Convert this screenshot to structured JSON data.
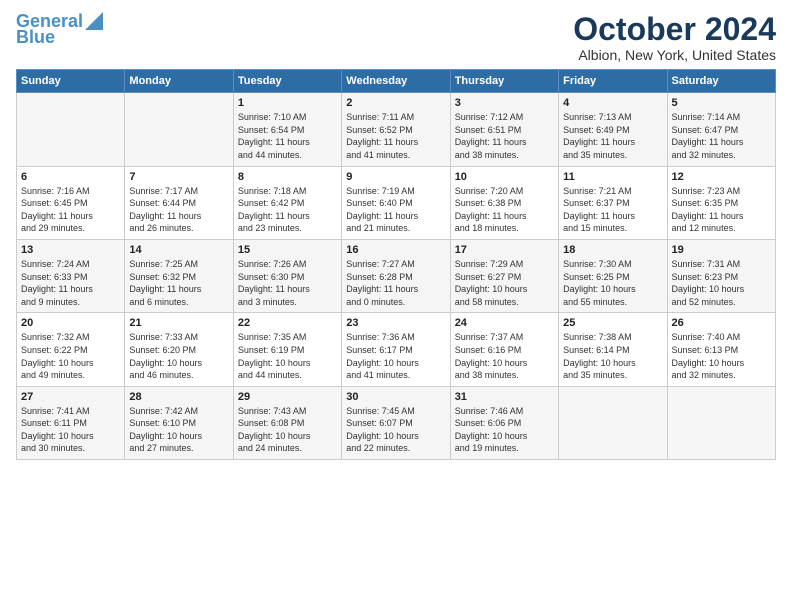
{
  "header": {
    "logo_line1": "General",
    "logo_line2": "Blue",
    "month": "October 2024",
    "location": "Albion, New York, United States"
  },
  "days_of_week": [
    "Sunday",
    "Monday",
    "Tuesday",
    "Wednesday",
    "Thursday",
    "Friday",
    "Saturday"
  ],
  "weeks": [
    [
      {
        "day": "",
        "info": ""
      },
      {
        "day": "",
        "info": ""
      },
      {
        "day": "1",
        "info": "Sunrise: 7:10 AM\nSunset: 6:54 PM\nDaylight: 11 hours\nand 44 minutes."
      },
      {
        "day": "2",
        "info": "Sunrise: 7:11 AM\nSunset: 6:52 PM\nDaylight: 11 hours\nand 41 minutes."
      },
      {
        "day": "3",
        "info": "Sunrise: 7:12 AM\nSunset: 6:51 PM\nDaylight: 11 hours\nand 38 minutes."
      },
      {
        "day": "4",
        "info": "Sunrise: 7:13 AM\nSunset: 6:49 PM\nDaylight: 11 hours\nand 35 minutes."
      },
      {
        "day": "5",
        "info": "Sunrise: 7:14 AM\nSunset: 6:47 PM\nDaylight: 11 hours\nand 32 minutes."
      }
    ],
    [
      {
        "day": "6",
        "info": "Sunrise: 7:16 AM\nSunset: 6:45 PM\nDaylight: 11 hours\nand 29 minutes."
      },
      {
        "day": "7",
        "info": "Sunrise: 7:17 AM\nSunset: 6:44 PM\nDaylight: 11 hours\nand 26 minutes."
      },
      {
        "day": "8",
        "info": "Sunrise: 7:18 AM\nSunset: 6:42 PM\nDaylight: 11 hours\nand 23 minutes."
      },
      {
        "day": "9",
        "info": "Sunrise: 7:19 AM\nSunset: 6:40 PM\nDaylight: 11 hours\nand 21 minutes."
      },
      {
        "day": "10",
        "info": "Sunrise: 7:20 AM\nSunset: 6:38 PM\nDaylight: 11 hours\nand 18 minutes."
      },
      {
        "day": "11",
        "info": "Sunrise: 7:21 AM\nSunset: 6:37 PM\nDaylight: 11 hours\nand 15 minutes."
      },
      {
        "day": "12",
        "info": "Sunrise: 7:23 AM\nSunset: 6:35 PM\nDaylight: 11 hours\nand 12 minutes."
      }
    ],
    [
      {
        "day": "13",
        "info": "Sunrise: 7:24 AM\nSunset: 6:33 PM\nDaylight: 11 hours\nand 9 minutes."
      },
      {
        "day": "14",
        "info": "Sunrise: 7:25 AM\nSunset: 6:32 PM\nDaylight: 11 hours\nand 6 minutes."
      },
      {
        "day": "15",
        "info": "Sunrise: 7:26 AM\nSunset: 6:30 PM\nDaylight: 11 hours\nand 3 minutes."
      },
      {
        "day": "16",
        "info": "Sunrise: 7:27 AM\nSunset: 6:28 PM\nDaylight: 11 hours\nand 0 minutes."
      },
      {
        "day": "17",
        "info": "Sunrise: 7:29 AM\nSunset: 6:27 PM\nDaylight: 10 hours\nand 58 minutes."
      },
      {
        "day": "18",
        "info": "Sunrise: 7:30 AM\nSunset: 6:25 PM\nDaylight: 10 hours\nand 55 minutes."
      },
      {
        "day": "19",
        "info": "Sunrise: 7:31 AM\nSunset: 6:23 PM\nDaylight: 10 hours\nand 52 minutes."
      }
    ],
    [
      {
        "day": "20",
        "info": "Sunrise: 7:32 AM\nSunset: 6:22 PM\nDaylight: 10 hours\nand 49 minutes."
      },
      {
        "day": "21",
        "info": "Sunrise: 7:33 AM\nSunset: 6:20 PM\nDaylight: 10 hours\nand 46 minutes."
      },
      {
        "day": "22",
        "info": "Sunrise: 7:35 AM\nSunset: 6:19 PM\nDaylight: 10 hours\nand 44 minutes."
      },
      {
        "day": "23",
        "info": "Sunrise: 7:36 AM\nSunset: 6:17 PM\nDaylight: 10 hours\nand 41 minutes."
      },
      {
        "day": "24",
        "info": "Sunrise: 7:37 AM\nSunset: 6:16 PM\nDaylight: 10 hours\nand 38 minutes."
      },
      {
        "day": "25",
        "info": "Sunrise: 7:38 AM\nSunset: 6:14 PM\nDaylight: 10 hours\nand 35 minutes."
      },
      {
        "day": "26",
        "info": "Sunrise: 7:40 AM\nSunset: 6:13 PM\nDaylight: 10 hours\nand 32 minutes."
      }
    ],
    [
      {
        "day": "27",
        "info": "Sunrise: 7:41 AM\nSunset: 6:11 PM\nDaylight: 10 hours\nand 30 minutes."
      },
      {
        "day": "28",
        "info": "Sunrise: 7:42 AM\nSunset: 6:10 PM\nDaylight: 10 hours\nand 27 minutes."
      },
      {
        "day": "29",
        "info": "Sunrise: 7:43 AM\nSunset: 6:08 PM\nDaylight: 10 hours\nand 24 minutes."
      },
      {
        "day": "30",
        "info": "Sunrise: 7:45 AM\nSunset: 6:07 PM\nDaylight: 10 hours\nand 22 minutes."
      },
      {
        "day": "31",
        "info": "Sunrise: 7:46 AM\nSunset: 6:06 PM\nDaylight: 10 hours\nand 19 minutes."
      },
      {
        "day": "",
        "info": ""
      },
      {
        "day": "",
        "info": ""
      }
    ]
  ]
}
